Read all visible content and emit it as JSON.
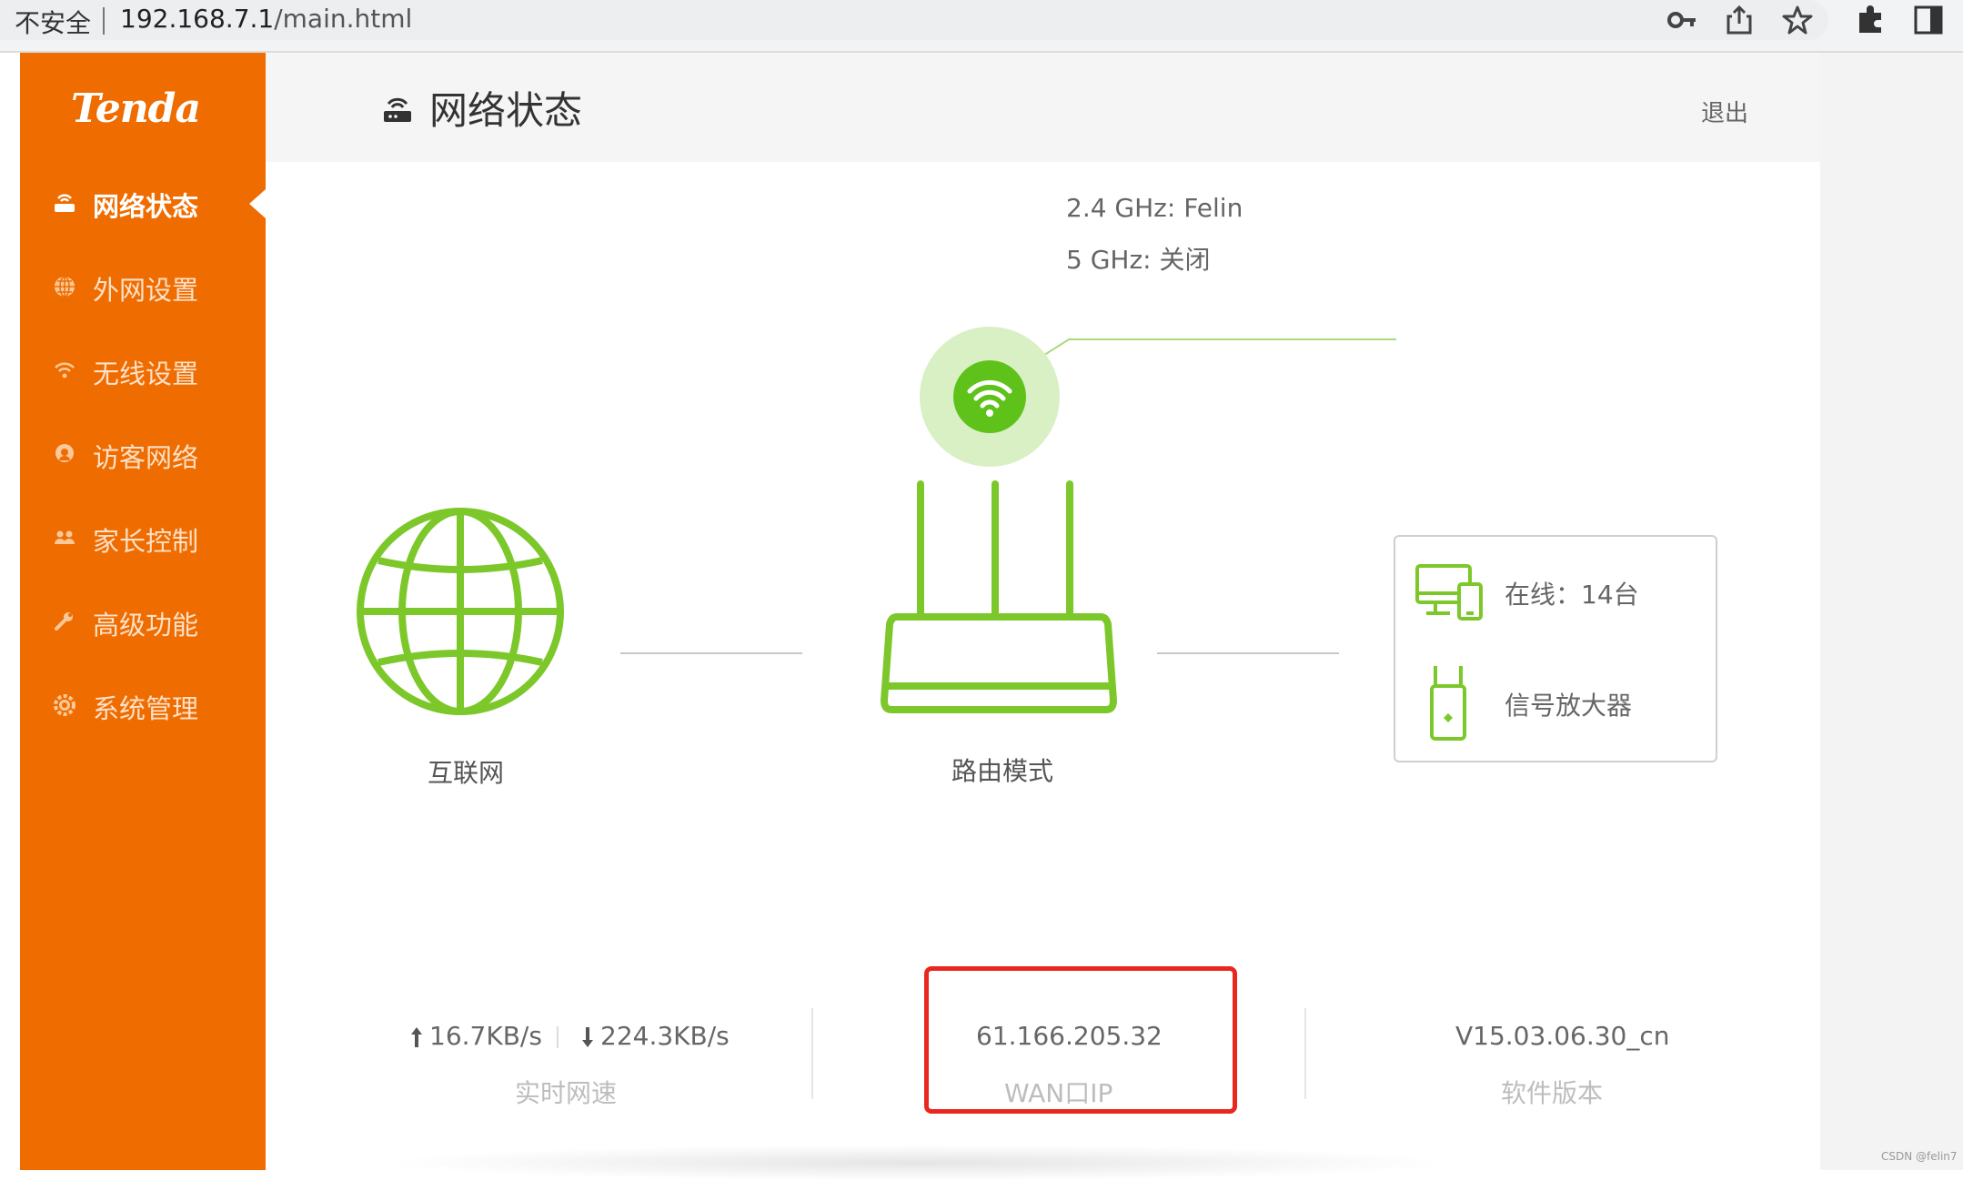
{
  "browser": {
    "security_label": "不安全",
    "url_host": "192.168.7.1",
    "url_path": "/main.html"
  },
  "brand": {
    "logo_text": "Tenda"
  },
  "sidebar": {
    "items": [
      {
        "label": "网络状态",
        "icon": "router-icon",
        "active": true
      },
      {
        "label": "外网设置",
        "icon": "globe-icon"
      },
      {
        "label": "无线设置",
        "icon": "wifi-icon"
      },
      {
        "label": "访客网络",
        "icon": "guest-icon"
      },
      {
        "label": "家长控制",
        "icon": "parent-icon"
      },
      {
        "label": "高级功能",
        "icon": "wrench-icon"
      },
      {
        "label": "系统管理",
        "icon": "gear-icon"
      }
    ]
  },
  "header": {
    "title": "网络状态",
    "logout": "退出"
  },
  "wifi": {
    "band24": "2.4 GHz: Felin",
    "band5": "5 GHz: 关闭"
  },
  "topology": {
    "internet_label": "互联网",
    "router_label": "路由模式",
    "online_devices": "在线：14台",
    "extender": "信号放大器"
  },
  "stats": {
    "upload": "16.7KB/s",
    "download": "224.3KB/s",
    "speed_label": "实时网速",
    "wan_ip": "61.166.205.32",
    "wan_label": "WAN口IP",
    "firmware": "V15.03.06.30_cn",
    "firmware_label": "软件版本"
  },
  "colors": {
    "brand_orange": "#ef6c00",
    "green": "#7cc82a",
    "highlight_red": "#e8281e"
  },
  "watermark": "CSDN @felin7"
}
